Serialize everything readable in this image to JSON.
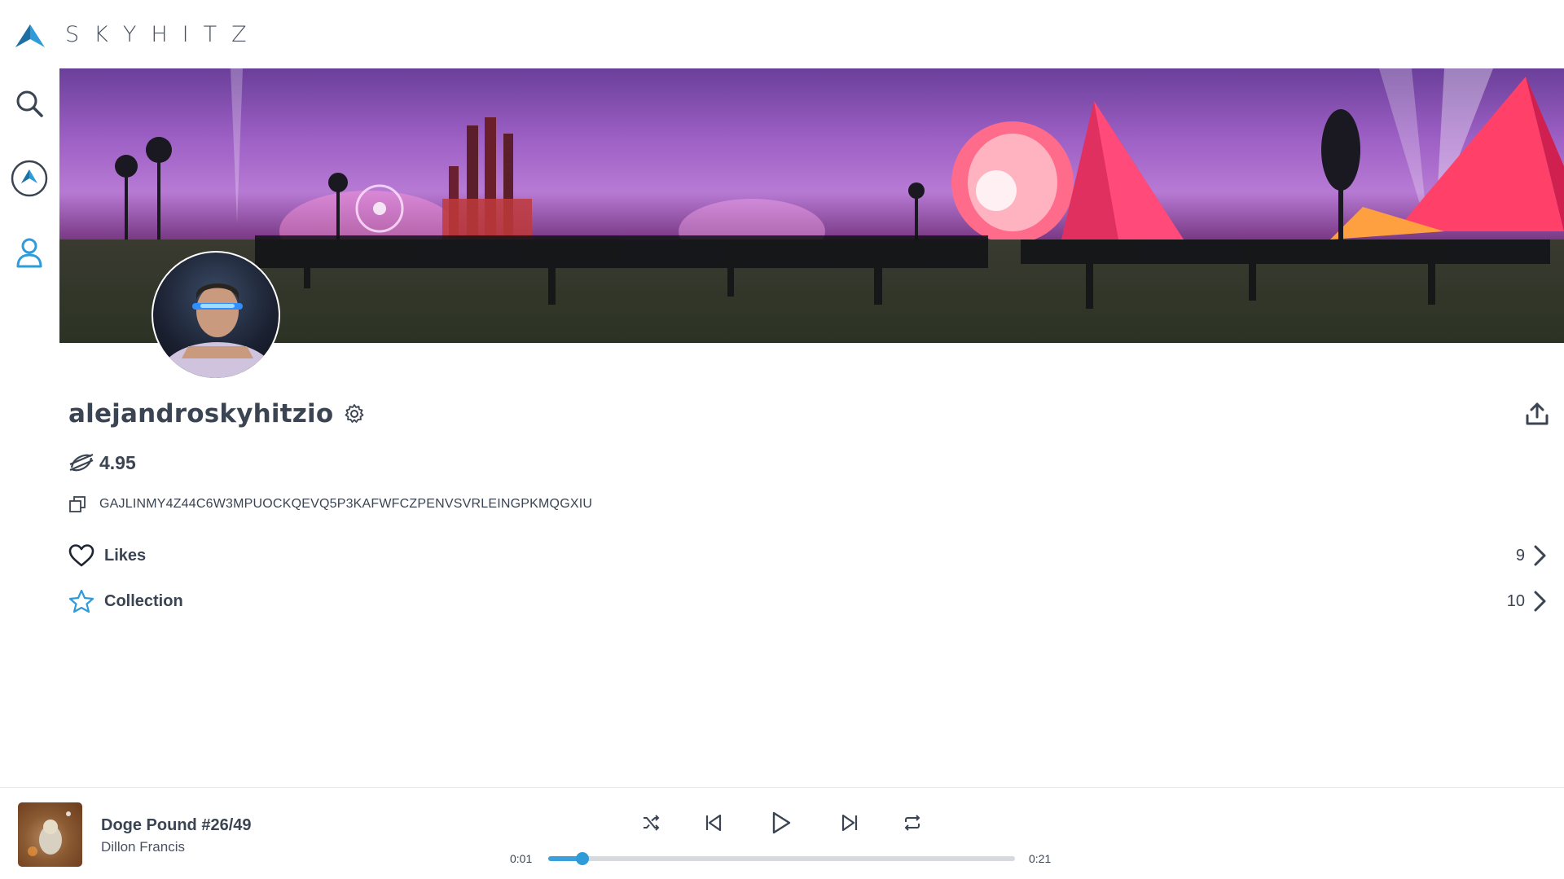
{
  "brand": {
    "name": "SKYHITZ",
    "accent_color": "#2f9bd9"
  },
  "sidebar": {
    "items": [
      {
        "icon": "search-icon"
      },
      {
        "icon": "skyhitz-logo-icon"
      },
      {
        "icon": "user-icon",
        "active": true
      }
    ]
  },
  "profile": {
    "username": "alejandroskyhitzio",
    "balance": "4.95",
    "balance_icon": "stellar-xlm-icon",
    "address": "GAJLINMY4Z44C6W3MPUOCKQEVQ5P3KAFWFCZPENVSVRLEINGPKMQGXIU"
  },
  "lists": [
    {
      "label": "Likes",
      "count": "9",
      "icon": "heart-icon"
    },
    {
      "label": "Collection",
      "count": "10",
      "icon": "star-icon"
    }
  ],
  "player": {
    "title": "Doge Pound #26/49",
    "artist": "Dillon Francis",
    "time_elapsed": "0:01",
    "time_total": "0:21",
    "progress": 0.073
  }
}
